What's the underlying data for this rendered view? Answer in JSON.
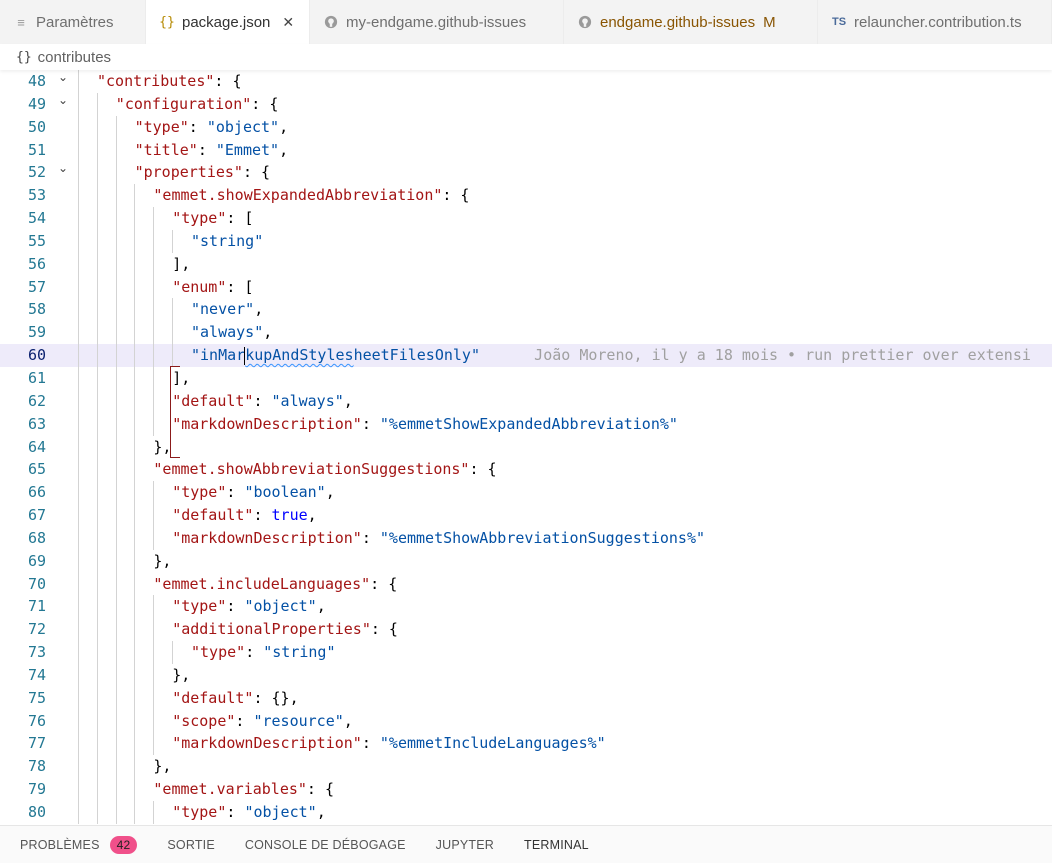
{
  "tabs": [
    {
      "label": "Paramètres",
      "icon": "settings-lines-icon",
      "active": false,
      "modified": false
    },
    {
      "label": "package.json",
      "icon": "json-braces-icon",
      "active": true,
      "modified": false
    },
    {
      "label": "my-endgame.github-issues",
      "icon": "github-icon",
      "active": false,
      "modified": false
    },
    {
      "label": "endgame.github-issues",
      "icon": "github-icon",
      "active": false,
      "modified": true,
      "modified_flag": "M"
    },
    {
      "label": "relauncher.contribution.ts",
      "icon": "typescript-icon",
      "icon_text": "TS",
      "active": false,
      "modified": false
    }
  ],
  "breadcrumb": {
    "icon": "json-braces-icon",
    "icon_text": "{}",
    "label": "contributes"
  },
  "editor": {
    "current_line": 60,
    "blame": "João Moreno, il y a 18 mois • run prettier over extensi",
    "lines": [
      {
        "n": "48",
        "fold": true,
        "indent": 1,
        "text": "\"contributes\": {"
      },
      {
        "n": "49",
        "fold": true,
        "indent": 2,
        "text": "\"configuration\": {"
      },
      {
        "n": "50",
        "fold": false,
        "indent": 3,
        "text": "\"type\": \"object\","
      },
      {
        "n": "51",
        "fold": false,
        "indent": 3,
        "text": "\"title\": \"Emmet\","
      },
      {
        "n": "52",
        "fold": true,
        "indent": 3,
        "text": "\"properties\": {"
      },
      {
        "n": "53",
        "fold": false,
        "indent": 4,
        "text": "\"emmet.showExpandedAbbreviation\": {"
      },
      {
        "n": "54",
        "fold": false,
        "indent": 5,
        "text": "\"type\": ["
      },
      {
        "n": "55",
        "fold": false,
        "indent": 6,
        "text": "\"string\""
      },
      {
        "n": "56",
        "fold": false,
        "indent": 5,
        "text": "],"
      },
      {
        "n": "57",
        "fold": false,
        "indent": 5,
        "text": "\"enum\": ["
      },
      {
        "n": "58",
        "fold": false,
        "indent": 6,
        "text": "\"never\","
      },
      {
        "n": "59",
        "fold": false,
        "indent": 6,
        "text": "\"always\","
      },
      {
        "n": "60",
        "fold": false,
        "indent": 6,
        "text": "\"inMarkupAndStylesheetFilesOnly\""
      },
      {
        "n": "61",
        "fold": false,
        "indent": 5,
        "text": "],"
      },
      {
        "n": "62",
        "fold": false,
        "indent": 5,
        "text": "\"default\": \"always\","
      },
      {
        "n": "63",
        "fold": false,
        "indent": 5,
        "text": "\"markdownDescription\": \"%emmetShowExpandedAbbreviation%\""
      },
      {
        "n": "64",
        "fold": false,
        "indent": 4,
        "text": "},"
      },
      {
        "n": "65",
        "fold": false,
        "indent": 4,
        "text": "\"emmet.showAbbreviationSuggestions\": {"
      },
      {
        "n": "66",
        "fold": false,
        "indent": 5,
        "text": "\"type\": \"boolean\","
      },
      {
        "n": "67",
        "fold": false,
        "indent": 5,
        "text": "\"default\": true,"
      },
      {
        "n": "68",
        "fold": false,
        "indent": 5,
        "text": "\"markdownDescription\": \"%emmetShowAbbreviationSuggestions%\""
      },
      {
        "n": "69",
        "fold": false,
        "indent": 4,
        "text": "},"
      },
      {
        "n": "70",
        "fold": false,
        "indent": 4,
        "text": "\"emmet.includeLanguages\": {"
      },
      {
        "n": "71",
        "fold": false,
        "indent": 5,
        "text": "\"type\": \"object\","
      },
      {
        "n": "72",
        "fold": false,
        "indent": 5,
        "text": "\"additionalProperties\": {"
      },
      {
        "n": "73",
        "fold": false,
        "indent": 6,
        "text": "\"type\": \"string\""
      },
      {
        "n": "74",
        "fold": false,
        "indent": 5,
        "text": "},"
      },
      {
        "n": "75",
        "fold": false,
        "indent": 5,
        "text": "\"default\": {},"
      },
      {
        "n": "76",
        "fold": false,
        "indent": 5,
        "text": "\"scope\": \"resource\","
      },
      {
        "n": "77",
        "fold": false,
        "indent": 5,
        "text": "\"markdownDescription\": \"%emmetIncludeLanguages%\""
      },
      {
        "n": "78",
        "fold": false,
        "indent": 4,
        "text": "},"
      },
      {
        "n": "79",
        "fold": false,
        "indent": 4,
        "text": "\"emmet.variables\": {"
      },
      {
        "n": "80",
        "fold": false,
        "indent": 5,
        "text": "\"type\": \"object\","
      }
    ]
  },
  "panel": {
    "tabs": [
      {
        "label": "PROBLÈMES",
        "badge": "42"
      },
      {
        "label": "SORTIE"
      },
      {
        "label": "CONSOLE DE DÉBOGAGE"
      },
      {
        "label": "JUPYTER"
      },
      {
        "label": "TERMINAL",
        "active": true
      }
    ]
  },
  "colors": {
    "badge": "#f0508a",
    "current_line": "#eeebfa",
    "json_key": "#a31515",
    "json_string": "#0451a5",
    "line_number": "#237893"
  }
}
